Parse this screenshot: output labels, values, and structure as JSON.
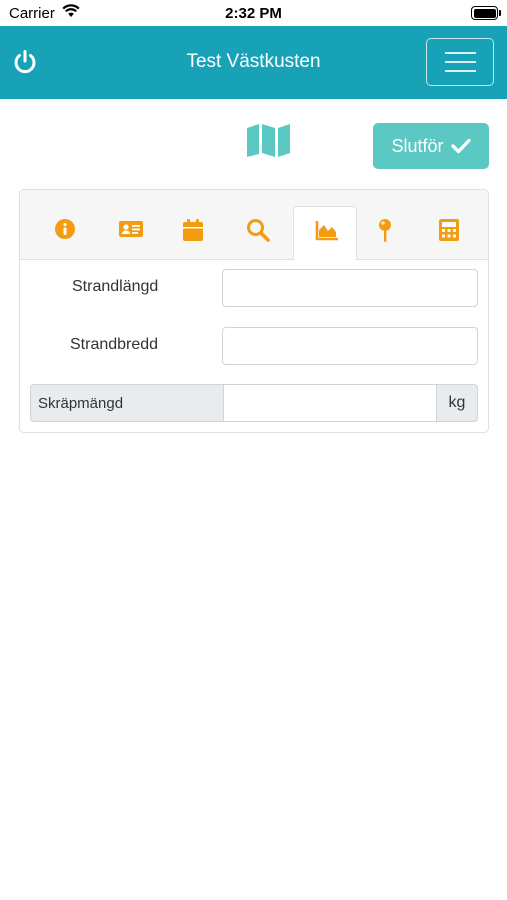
{
  "status_bar": {
    "carrier": "Carrier",
    "time": "2:32 PM",
    "icons": [
      "wifi-icon",
      "battery-icon"
    ]
  },
  "navbar": {
    "title": "Test Västkusten",
    "background": "#17a2b8",
    "left_icon": "power-icon",
    "right_icon": "hamburger-menu-icon"
  },
  "toolbar": {
    "map_icon": "map-icon",
    "finish_label": "Slutför",
    "finish_icon": "check-icon",
    "accent": "#5bc8c3"
  },
  "tabs": {
    "icon_color": "#f39c12",
    "active_index": 4,
    "items": [
      {
        "icon": "info-circle-icon"
      },
      {
        "icon": "id-card-icon"
      },
      {
        "icon": "calendar-icon"
      },
      {
        "icon": "search-icon"
      },
      {
        "icon": "area-chart-icon"
      },
      {
        "icon": "map-pin-icon"
      },
      {
        "icon": "calculator-icon"
      }
    ]
  },
  "form": {
    "strandlangd_label": "Strandlängd",
    "strandlangd_value": "",
    "strandbredd_label": "Strandbredd",
    "strandbredd_value": "",
    "skrapmangd_label": "Skräpmängd",
    "skrapmangd_value": "",
    "skrapmangd_unit": "kg"
  }
}
